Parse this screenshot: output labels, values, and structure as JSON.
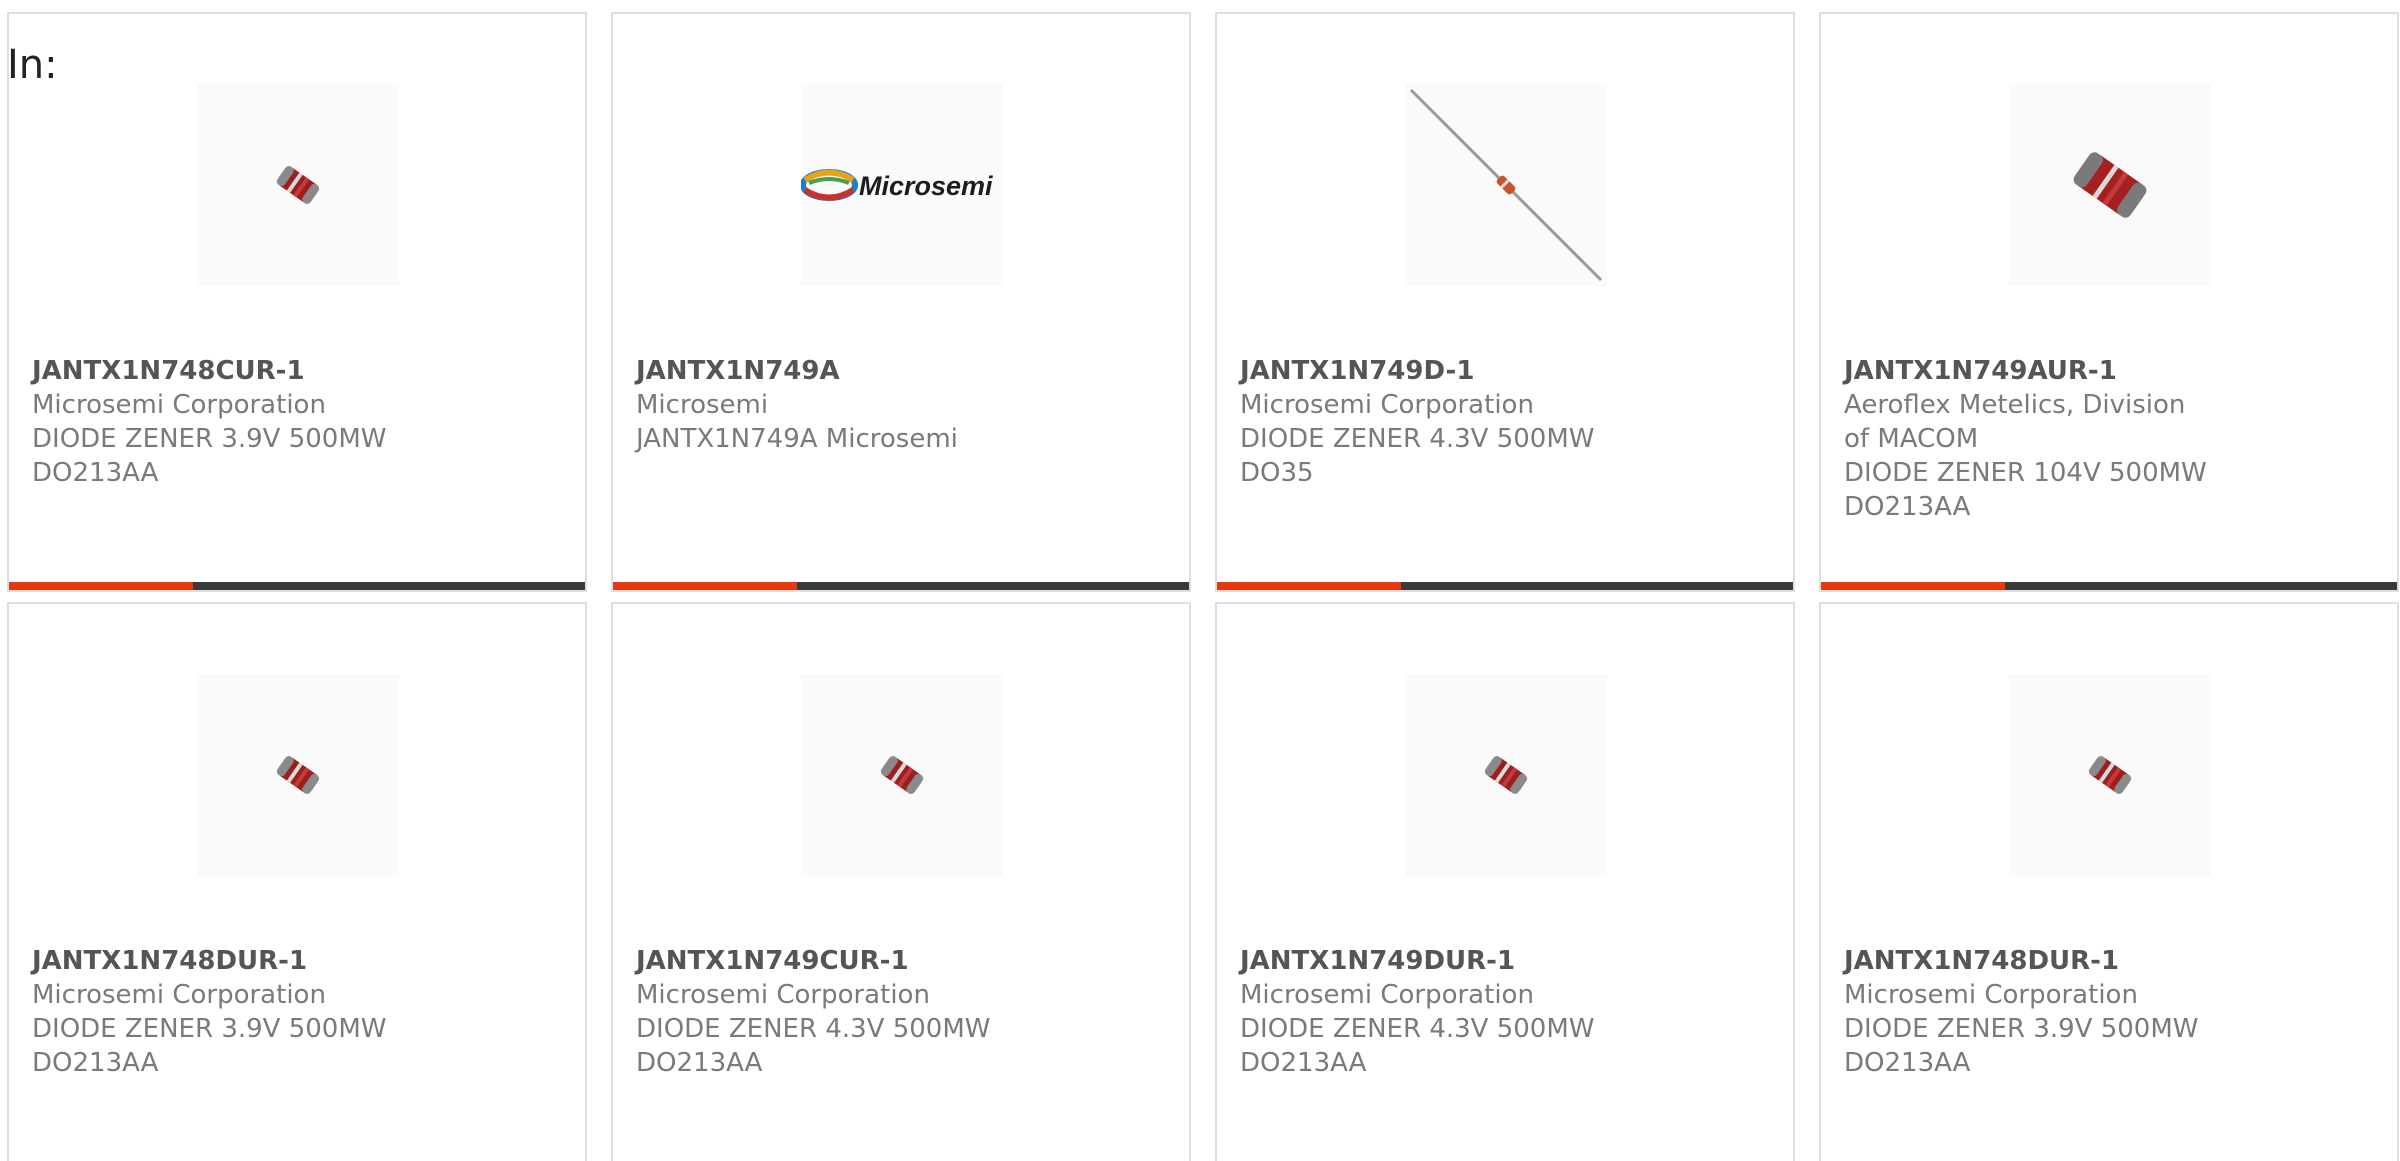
{
  "in_label": "In:",
  "colors": {
    "accent": "#e8390e",
    "bar": "#3a3a3a",
    "border": "#dedede",
    "text": "#7a7a7a"
  },
  "products": [
    {
      "part_number": "JANTX1N748CUR-1",
      "manufacturer": "Microsemi Corporation",
      "description_line1": "DIODE ZENER 3.9V 500MW",
      "description_line2": "DO213AA",
      "image": "melf-diode-small",
      "progress": 0.32
    },
    {
      "part_number": "JANTX1N749A",
      "manufacturer": "Microsemi",
      "description_line1": "JANTX1N749A Microsemi",
      "description_line2": "",
      "image": "microsemi-logo",
      "logo_text": "Microsemi",
      "progress": 0.32
    },
    {
      "part_number": "JANTX1N749D-1",
      "manufacturer": "Microsemi Corporation",
      "description_line1": "DIODE ZENER 4.3V 500MW DO35",
      "description_line2": "",
      "image": "axial-diode",
      "progress": 0.32
    },
    {
      "part_number": "JANTX1N749AUR-1",
      "manufacturer": "Aeroflex Metelics, Division of MACOM",
      "description_line1": "DIODE ZENER 104V 500MW",
      "description_line2": "DO213AA",
      "image": "melf-diode-large",
      "progress": 0.32
    },
    {
      "part_number": "JANTX1N748DUR-1",
      "manufacturer": "Microsemi Corporation",
      "description_line1": "DIODE ZENER 3.9V 500MW",
      "description_line2": "DO213AA",
      "image": "melf-diode-small",
      "progress": 0
    },
    {
      "part_number": "JANTX1N749CUR-1",
      "manufacturer": "Microsemi Corporation",
      "description_line1": "DIODE ZENER 4.3V 500MW",
      "description_line2": "DO213AA",
      "image": "melf-diode-small",
      "progress": 0
    },
    {
      "part_number": "JANTX1N749DUR-1",
      "manufacturer": "Microsemi Corporation",
      "description_line1": "DIODE ZENER 4.3V 500MW",
      "description_line2": "DO213AA",
      "image": "melf-diode-small",
      "progress": 0
    },
    {
      "part_number": "JANTX1N748DUR-1",
      "manufacturer": "Microsemi Corporation",
      "description_line1": "DIODE ZENER 3.9V 500MW",
      "description_line2": "DO213AA",
      "image": "melf-diode-small",
      "progress": 0
    }
  ]
}
